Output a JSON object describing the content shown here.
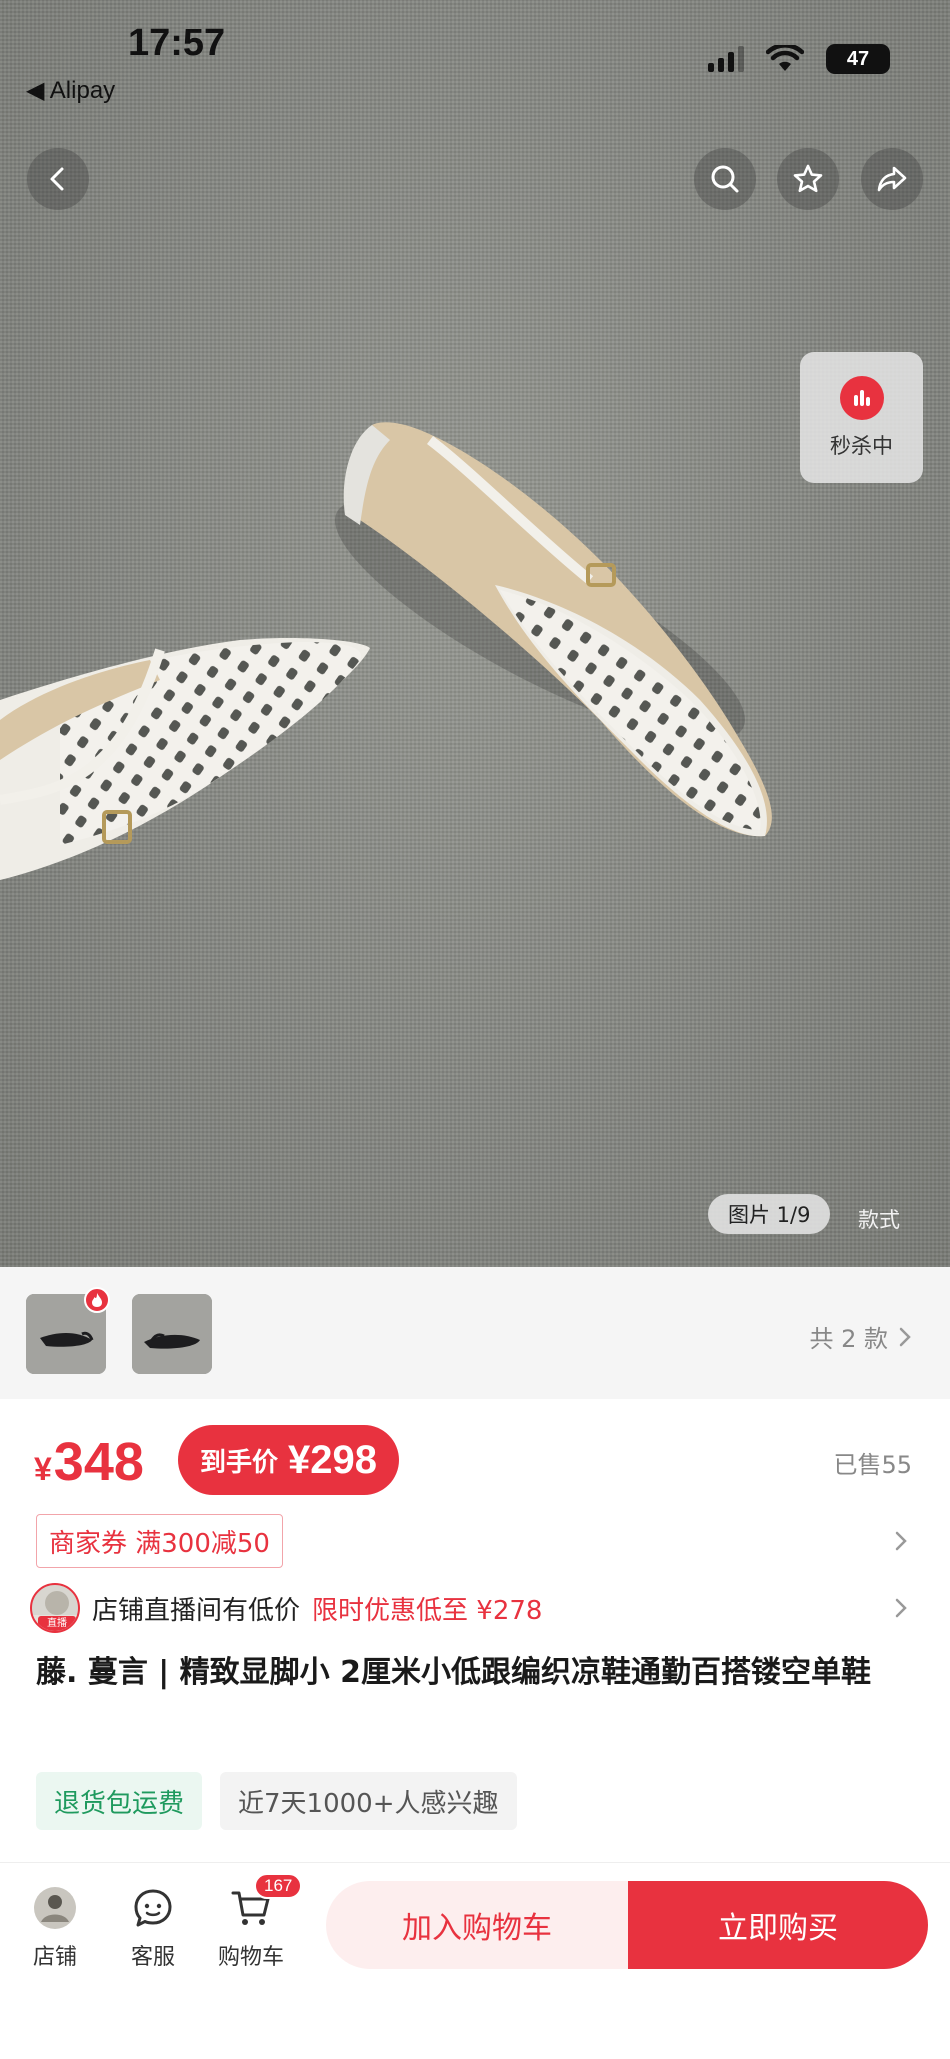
{
  "status_bar": {
    "time": "17:57",
    "back_app": "◀ Alipay",
    "battery": "47"
  },
  "nav": {
    "icons": [
      "back-icon",
      "search-icon",
      "star-icon",
      "share-icon"
    ]
  },
  "flash_sale": {
    "label": "秒杀中"
  },
  "gallery": {
    "counter": "图片 1/9",
    "style_tab": "款式"
  },
  "variants": {
    "count_label": "共 2 款"
  },
  "price": {
    "currency": "¥",
    "original": "348",
    "final_label": "到手价",
    "final_value": "¥298",
    "sold": "已售55"
  },
  "coupon": {
    "label": "商家券 满300减50"
  },
  "live": {
    "tag": "直播",
    "text": "店铺直播间有低价",
    "promo": "限时优惠低至 ¥278"
  },
  "product": {
    "title": "藤. 蔓言 | 精致显脚小 2厘米小低跟编织凉鞋通勤百搭镂空单鞋"
  },
  "tags": {
    "shipping": "退货包运费",
    "interest": "近7天1000+人感兴趣"
  },
  "bottom_bar": {
    "shop": "店铺",
    "service": "客服",
    "cart": "购物车",
    "cart_count": "167",
    "add_to_cart": "加入购物车",
    "buy_now": "立即购买"
  },
  "colors": {
    "accent": "#e8323f",
    "green": "#1f9a5e"
  }
}
